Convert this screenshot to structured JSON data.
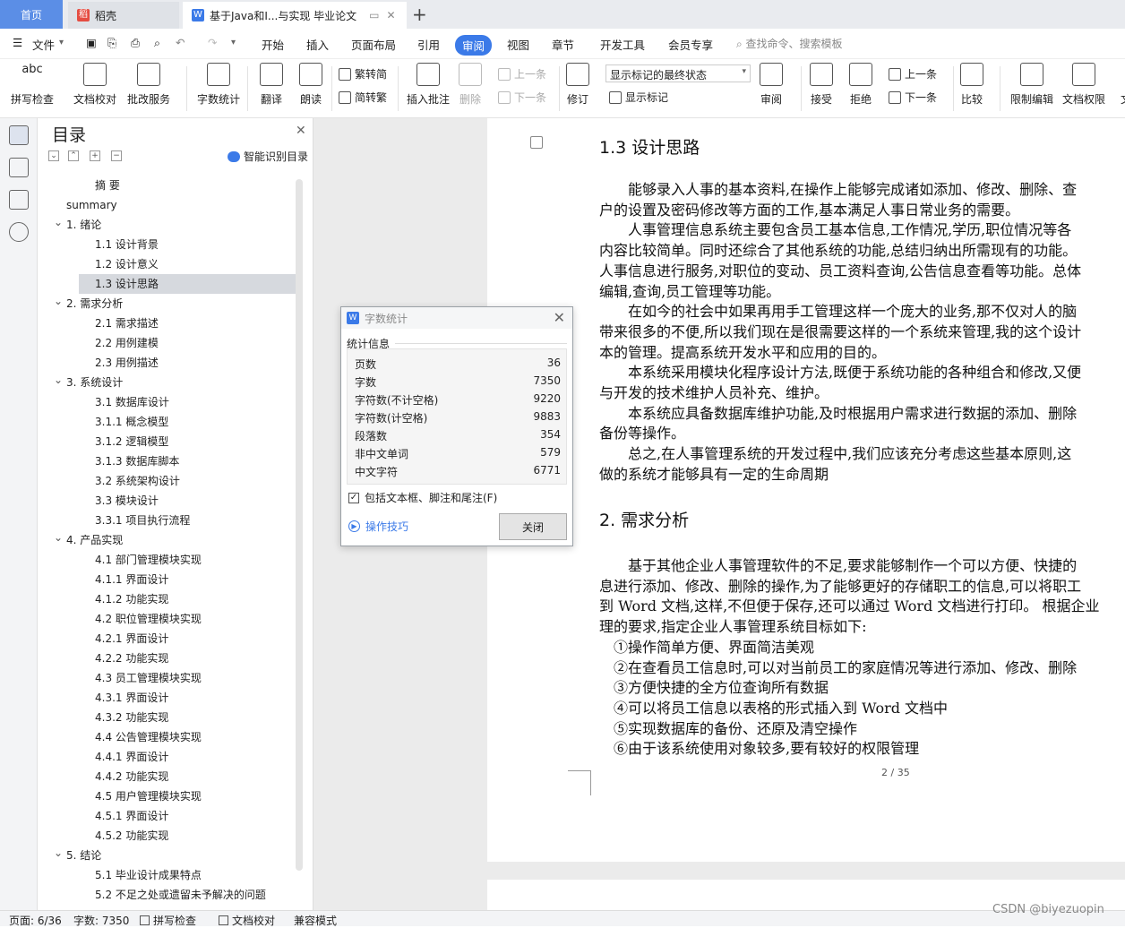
{
  "tabs": {
    "home": "首页",
    "daoke": "稻壳",
    "doc": "基于Java和I...与实现 毕业论文",
    "add": "+"
  },
  "menu": [
    "文件",
    "开始",
    "插入",
    "页面布局",
    "引用",
    "审阅",
    "视图",
    "章节",
    "开发工具",
    "会员专享"
  ],
  "search_placeholder": "查找命令、搜索模板",
  "ribbon": {
    "spell": "拼写检查",
    "doc_check": "文档校对",
    "annot_service": "批改服务",
    "word_count": "字数统计",
    "translate": "翻译",
    "read_aloud": "朗读",
    "trad": "繁转简",
    "simp": "简转繁",
    "insert_comment": "插入批注",
    "delete": "删除",
    "prev": "上一条",
    "next": "下一条",
    "revise": "修订",
    "markup_mode": "显示标记的最终状态",
    "show_markup": "显示标记",
    "review": "审阅",
    "accept": "接受",
    "reject": "拒绝",
    "prev2": "上一条",
    "next2": "下一条",
    "compare": "比较",
    "restrict": "限制编辑",
    "permission": "文档权限",
    "more": "文"
  },
  "toc": {
    "title": "目录",
    "smart": "智能识别目录",
    "items": [
      "摘 要",
      "summary",
      "1. 绪论",
      "1.1 设计背景",
      "1.2 设计意义",
      "1.3 设计思路",
      "2. 需求分析",
      "2.1 需求描述",
      "2.2 用例建模",
      "2.3 用例描述",
      "3. 系统设计",
      "3.1 数据库设计",
      "3.1.1 概念模型",
      "3.1.2 逻辑模型",
      "3.1.3 数据库脚本",
      "3.2 系统架构设计",
      "3.3 模块设计",
      "3.3.1 项目执行流程",
      "4. 产品实现",
      "4.1 部门管理模块实现",
      "4.1.1 界面设计",
      "4.1.2 功能实现",
      "4.2 职位管理模块实现",
      "4.2.1 界面设计",
      "4.2.2 功能实现",
      "4.3 员工管理模块实现",
      "4.3.1 界面设计",
      "4.3.2 功能实现",
      "4.4 公告管理模块实现",
      "4.4.1 界面设计",
      "4.4.2 功能实现",
      "4.5 用户管理模块实现",
      "4.5.1 界面设计",
      "4.5.2 功能实现",
      "5. 结论",
      "5.1 毕业设计成果特点",
      "5.2 不足之处或遗留未予解决的问题"
    ]
  },
  "dialog": {
    "title": "字数统计",
    "group": "统计信息",
    "stats": [
      {
        "label": "页数",
        "value": "36"
      },
      {
        "label": "字数",
        "value": "7350"
      },
      {
        "label": "字符数(不计空格)",
        "value": "9220"
      },
      {
        "label": "字符数(计空格)",
        "value": "9883"
      },
      {
        "label": "段落数",
        "value": "354"
      },
      {
        "label": "非中文单词",
        "value": "579"
      },
      {
        "label": "中文字符",
        "value": "6771"
      }
    ],
    "checkbox": "包括文本框、脚注和尾注(F)",
    "tips": "操作技巧",
    "close": "关闭"
  },
  "page": {
    "heading1": "1.3 设计思路",
    "lines1": [
      "　　能够录入人事的基本资料,在操作上能够完成诸如添加、修改、删除、查",
      "户的设置及密码修改等方面的工作,基本满足人事日常业务的需要。",
      "　　人事管理信息系统主要包含员工基本信息,工作情况,学历,职位情况等各",
      "内容比较简单。同时还综合了其他系统的功能,总结归纳出所需现有的功能。",
      "人事信息进行服务,对职位的变动、员工资料查询,公告信息查看等功能。总体",
      "编辑,查询,员工管理等功能。",
      "　　在如今的社会中如果再用手工管理这样一个庞大的业务,那不仅对人的脑",
      "带来很多的不便,所以我们现在是很需要这样的一个系统来管理,我的这个设计",
      "本的管理。提高系统开发水平和应用的目的。",
      "　　本系统采用模块化程序设计方法,既便于系统功能的各种组合和修改,又便",
      "与开发的技术维护人员补充、维护。",
      "　　本系统应具备数据库维护功能,及时根据用户需求进行数据的添加、删除",
      "备份等操作。",
      "　　总之,在人事管理系统的开发过程中,我们应该充分考虑这些基本原则,这",
      "做的系统才能够具有一定的生命周期"
    ],
    "heading2": "2.  需求分析",
    "lines2": [
      "　　基于其他企业人事管理软件的不足,要求能够制作一个可以方便、快捷的",
      "息进行添加、修改、删除的操作,为了能够更好的存储职工的信息,可以将职工",
      "到 Word 文档,这样,不但便于保存,还可以通过 Word 文档进行打印。 根据企业",
      "理的要求,指定企业人事管理系统目标如下:",
      "　①操作简单方便、界面简洁美观",
      "　②在查看员工信息时,可以对当前员工的家庭情况等进行添加、修改、删除",
      "　③方便快捷的全方位查询所有数据",
      "　④可以将员工信息以表格的形式插入到 Word 文档中",
      "　⑤实现数据库的备份、还原及清空操作",
      "　⑥由于该系统使用对象较多,要有较好的权限管理"
    ],
    "page_number": "2 / 35"
  },
  "status": {
    "page": "页面: 6/36",
    "words": "字数: 7350",
    "spell": "拼写检查",
    "doccheck": "文档校对",
    "compat": "兼容模式"
  },
  "watermark": "CSDN @biyezuopin"
}
